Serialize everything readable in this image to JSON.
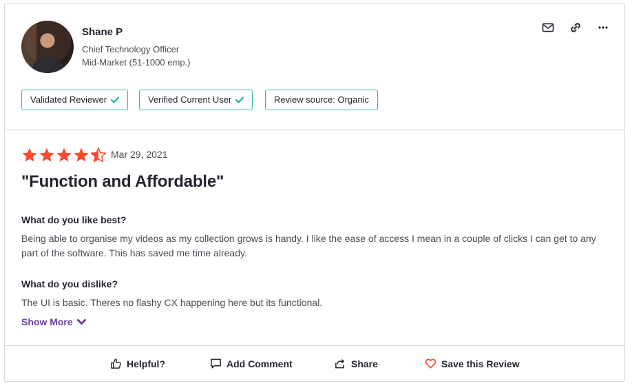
{
  "reviewer": {
    "name": "Shane P",
    "title": "Chief Technology Officer",
    "company_size": "Mid-Market (51-1000 emp.)"
  },
  "header_actions": [
    "mail-icon",
    "link-icon",
    "more-icon"
  ],
  "badges": [
    {
      "label": "Validated Reviewer",
      "checked": true
    },
    {
      "label": "Verified Current User",
      "checked": true
    },
    {
      "label": "Review source: Organic",
      "checked": false
    }
  ],
  "review": {
    "rating": 4.5,
    "rating_max": 5,
    "date": "Mar 29, 2021",
    "title": "\"Function and Affordable\"",
    "like_question": "What do you like best?",
    "like_answer": "Being able to organise my videos as my collection grows is handy. I like the ease of access I mean in a couple of clicks I can get to any part of the software. This has saved me time already.",
    "dislike_question": "What do you dislike?",
    "dislike_answer": "The UI is basic. Theres no flashy CX happening here but its functional.",
    "show_more": "Show More"
  },
  "footer": {
    "helpful": "Helpful?",
    "add_comment": "Add Comment",
    "share": "Share",
    "save": "Save this Review"
  },
  "colors": {
    "star": "#ff492c",
    "badge_border": "#2db9a2",
    "check": "#2db9a2",
    "link_purple": "#6a3ea1",
    "heart": "#ff492c"
  }
}
